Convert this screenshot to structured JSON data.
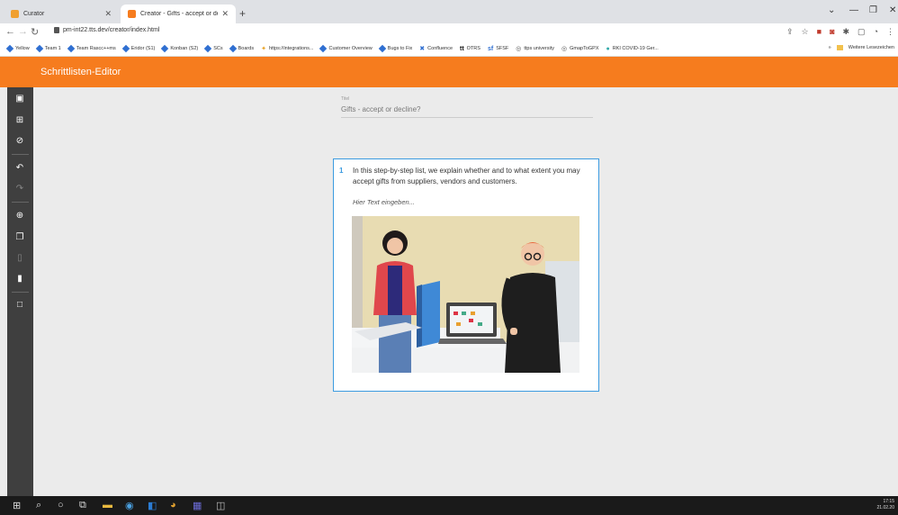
{
  "browser": {
    "tabs": [
      {
        "title": "Curator",
        "active": false,
        "favicon_color": "#f0a030"
      },
      {
        "title": "Creator - Gifts - accept or decline",
        "active": true,
        "favicon_color": "#f67c1e"
      }
    ],
    "new_tab": "+",
    "url": "pm-int22.tts.dev/creator/index.html",
    "bookmarks": [
      "Yellow",
      "Team 1",
      "Team Rascc++ms",
      "Eridor (S1)",
      "Konban (S2)",
      "SCs",
      "Boards",
      "https://integrations...",
      "Customer Overview",
      "Bugs to Fix",
      "Confluence",
      "OTRS",
      "SFSF",
      "ttps university",
      "GmapToGPX",
      "RKI COVID-19 Ger..."
    ],
    "bookmarks_right": "Weitere Lesezeichen"
  },
  "app": {
    "title": "Schrittlisten-Editor",
    "accent_color": "#f67c1e",
    "sidebar_icons": [
      "save-icon",
      "save-as-icon",
      "cancel-icon",
      "undo-icon",
      "redo-icon",
      "add-step-icon",
      "copy-icon",
      "paste-icon",
      "delete-icon",
      "frame-icon"
    ]
  },
  "editor": {
    "title_label": "Titel",
    "title_value": "Gifts - accept or decline?",
    "step": {
      "number": "1",
      "text": "In this step-by-step list, we explain whether and to what extent you may accept gifts from suppliers, vendors and customers.",
      "placeholder": "Hier Text eingeben..."
    }
  },
  "taskbar": {
    "time": "17:15",
    "date": "21.02.20"
  }
}
